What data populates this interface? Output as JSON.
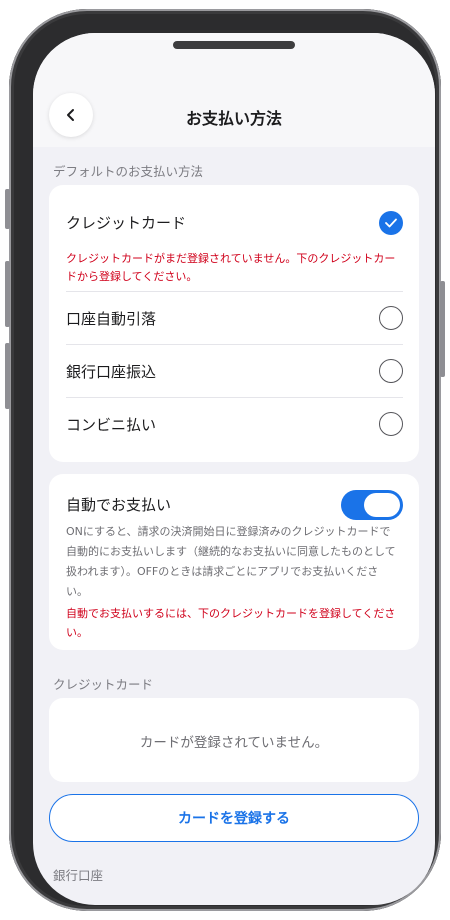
{
  "nav": {
    "title": "お支払い方法",
    "back_icon": "chevron-left-icon"
  },
  "default_payment": {
    "section_label": "デフォルトのお支払い方法",
    "options": [
      {
        "label": "クレジットカード",
        "selected": true
      },
      {
        "label": "口座自動引落",
        "selected": false
      },
      {
        "label": "銀行口座振込",
        "selected": false
      },
      {
        "label": "コンビニ払い",
        "selected": false
      }
    ],
    "credit_error_line1": "クレジットカードがまだ登録されていません。下のクレジットカー",
    "credit_error_line2": "ドから登録してください。"
  },
  "auto_pay": {
    "label": "自動でお支払い",
    "enabled": true,
    "description_lines": [
      "ONにすると、請求の決済開始日に登録済みのクレジットカードで",
      "自動的にお支払いします（継続的なお支払いに同意したものとして",
      "扱われます）。OFFのときは請求ごとにアプリでお支払いくださ",
      "い。"
    ],
    "error_line1": "自動でお支払いするには、下のクレジットカードを登録してくださ",
    "error_line2": "い。"
  },
  "credit_card": {
    "section_label": "クレジットカード",
    "empty_message": "カードが登録されていません。",
    "register_button": "カードを登録する"
  },
  "bank_account": {
    "section_label": "銀行口座"
  },
  "colors": {
    "accent": "#1a73e8",
    "error": "#d0011b",
    "background": "#f1f1f6"
  }
}
